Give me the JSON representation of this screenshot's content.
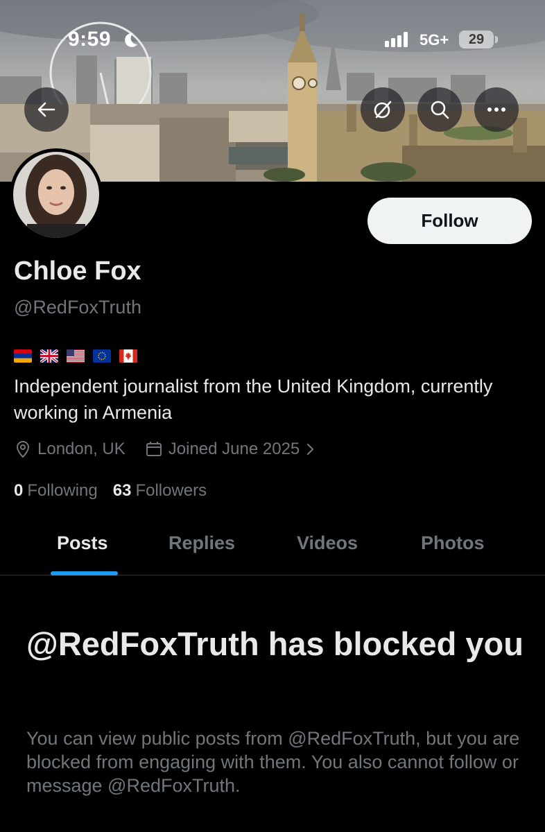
{
  "status_bar": {
    "time": "9:59",
    "network": "5G+",
    "battery": "29",
    "focus_icon": "moon-icon",
    "signal_icon": "cellular-signal-icon"
  },
  "header": {
    "back_icon": "back-arrow-icon",
    "grok_icon": "grok-icon",
    "search_icon": "search-icon",
    "more_icon": "more-icon"
  },
  "profile": {
    "display_name": "Chloe Fox",
    "handle": "@RedFoxTruth",
    "flags": [
      "armenia-flag",
      "uk-flag",
      "us-flag",
      "eu-flag",
      "canada-flag"
    ],
    "bio": "Independent journalist from the United Kingdom, currently working in Armenia",
    "location": "London, UK",
    "joined": "Joined June 2025",
    "following_count": "0",
    "following_label": "Following",
    "followers_count": "63",
    "followers_label": "Followers",
    "follow_label": "Follow"
  },
  "tabs": [
    {
      "label": "Posts",
      "active": true
    },
    {
      "label": "Replies",
      "active": false
    },
    {
      "label": "Videos",
      "active": false
    },
    {
      "label": "Photos",
      "active": false
    }
  ],
  "blocked": {
    "title": "@RedFoxTruth has blocked you",
    "description": "You can view public posts from @RedFoxTruth, but you are blocked from engaging with them. You also cannot follow or message @RedFoxTruth."
  },
  "colors": {
    "background": "#000000",
    "text_primary": "#e7e9ea",
    "text_secondary": "#71767b",
    "accent": "#1d9bf0",
    "follow_button": "#eff3f4"
  }
}
